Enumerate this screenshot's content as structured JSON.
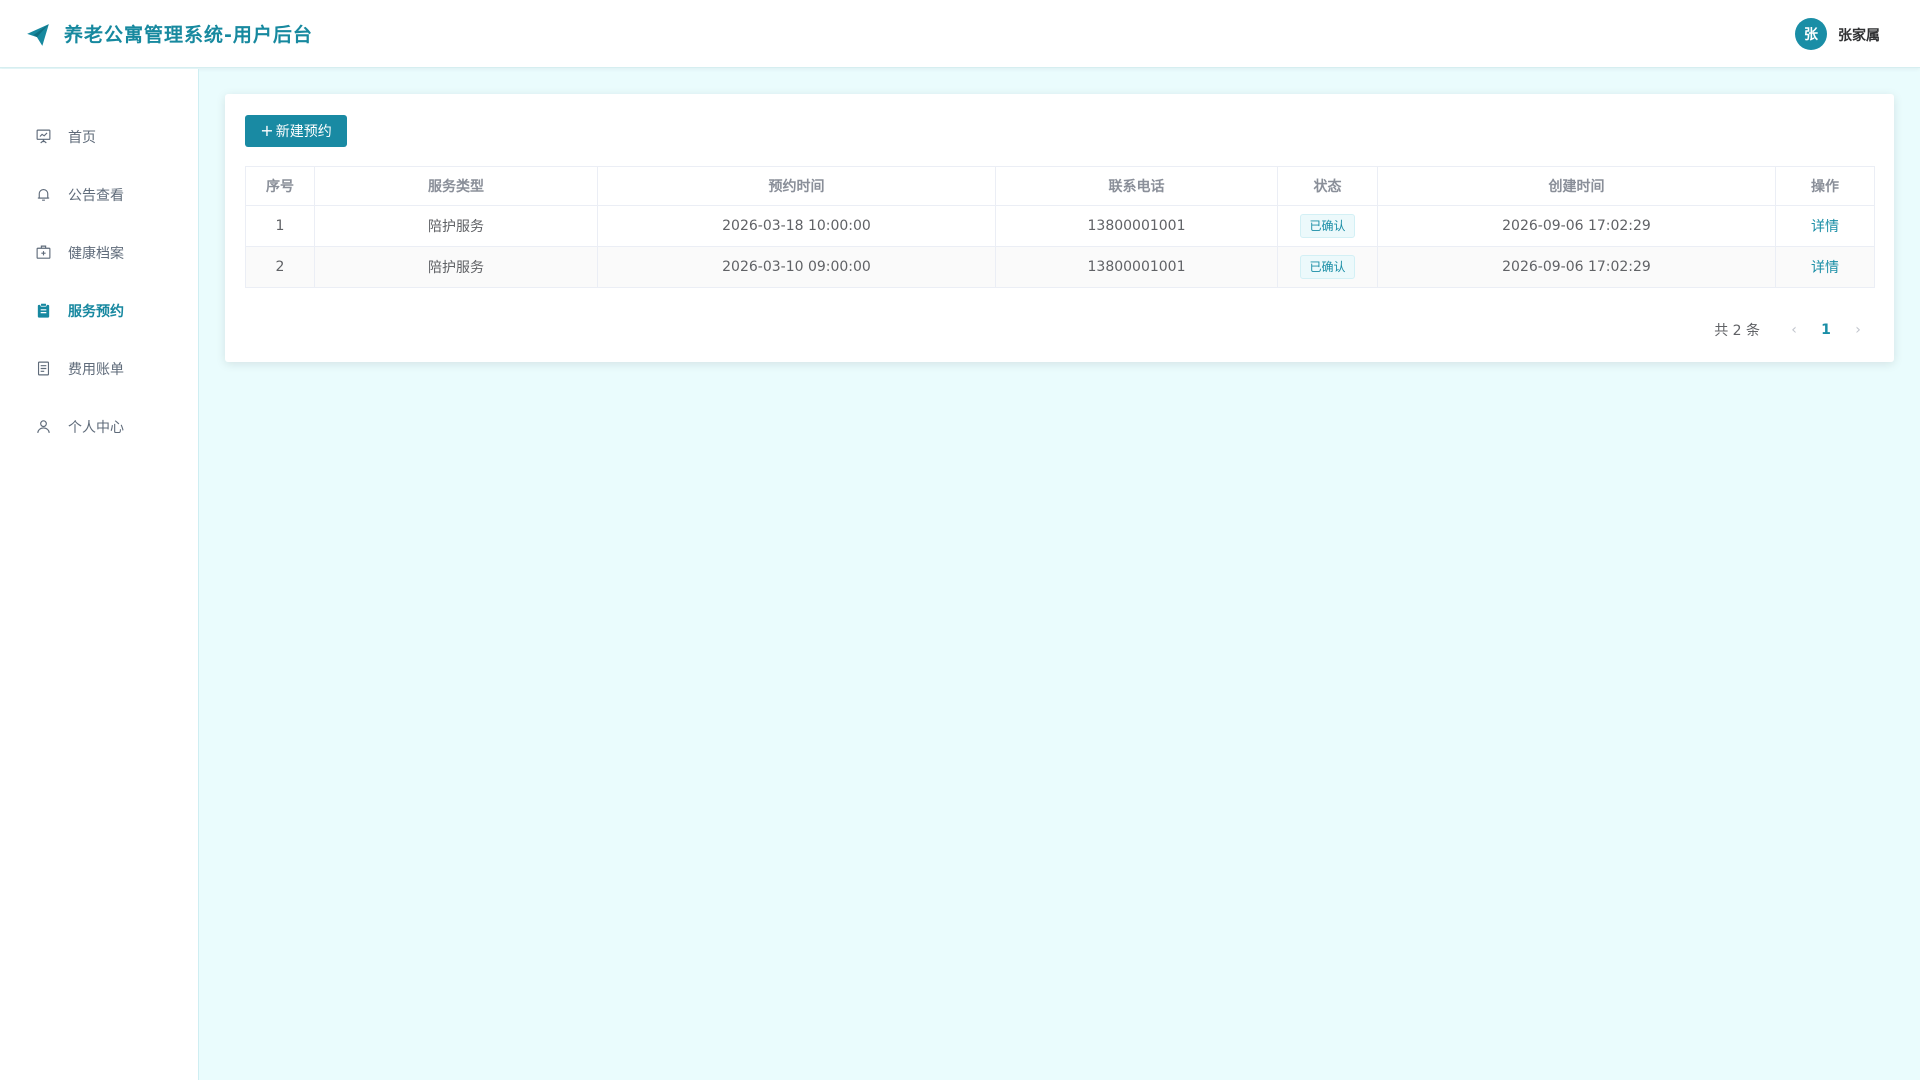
{
  "app": {
    "title": "养老公寓管理系统-用户后台"
  },
  "user": {
    "avatar_char": "张",
    "name": "张家属"
  },
  "sidebar": {
    "items": [
      {
        "label": "首页",
        "icon": "presentation-chart-icon",
        "active": false
      },
      {
        "label": "公告查看",
        "icon": "bell-icon",
        "active": false
      },
      {
        "label": "健康档案",
        "icon": "medical-box-icon",
        "active": false
      },
      {
        "label": "服务预约",
        "icon": "clipboard-icon",
        "active": true
      },
      {
        "label": "费用账单",
        "icon": "document-icon",
        "active": false
      },
      {
        "label": "个人中心",
        "icon": "user-icon",
        "active": false
      }
    ]
  },
  "toolbar": {
    "new_button_label": "新建预约"
  },
  "table": {
    "headers": [
      "序号",
      "服务类型",
      "预约时间",
      "联系电话",
      "状态",
      "创建时间",
      "操作"
    ],
    "rows": [
      {
        "index": "1",
        "service_type": "陪护服务",
        "appointment_time": "2026-03-18 10:00:00",
        "phone": "13800001001",
        "status": "已确认",
        "created_at": "2026-09-06 17:02:29",
        "action": "详情"
      },
      {
        "index": "2",
        "service_type": "陪护服务",
        "appointment_time": "2026-03-10 09:00:00",
        "phone": "13800001001",
        "status": "已确认",
        "created_at": "2026-09-06 17:02:29",
        "action": "详情"
      }
    ]
  },
  "pagination": {
    "total_text": "共 2 条",
    "current_page": "1",
    "prev_symbol": "‹",
    "next_symbol": "›"
  },
  "colors": {
    "accent": "#198aa3",
    "background": "#eafcfd"
  }
}
